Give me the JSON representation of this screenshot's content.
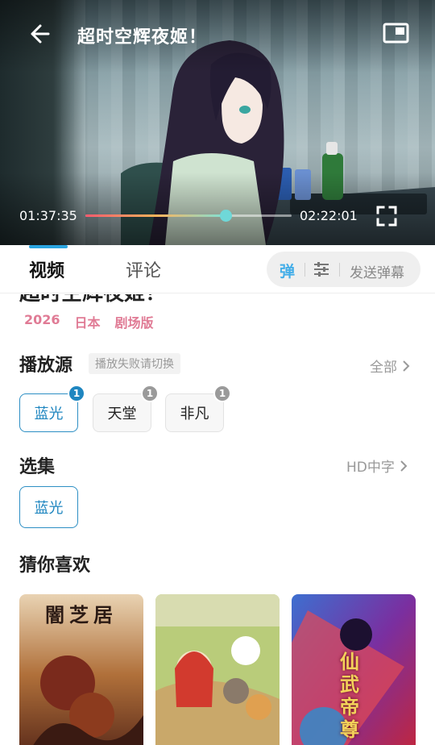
{
  "player": {
    "title": "超时空辉夜姬！",
    "current_time": "01:37:35",
    "total_time": "02:22:01",
    "progress": 0.68
  },
  "tabs": {
    "video": "视频",
    "comment": "评论"
  },
  "danmaku": {
    "toggle_label": "弹",
    "send_label": "发送弹幕"
  },
  "details": {
    "title": "超时空辉夜姬！",
    "year": "2026",
    "region": "日本",
    "kind": "剧场版"
  },
  "sources": {
    "heading": "播放源",
    "hint": "播放失败请切换",
    "more": "全部",
    "items": [
      {
        "label": "蓝光",
        "count": "1",
        "active": true
      },
      {
        "label": "天堂",
        "count": "1",
        "active": false
      },
      {
        "label": "非凡",
        "count": "1",
        "active": false
      }
    ]
  },
  "episodes": {
    "heading": "选集",
    "more": "HD中字",
    "items": [
      {
        "label": "蓝光"
      }
    ]
  },
  "recommend": {
    "heading": "猜你喜欢",
    "posters": [
      {
        "title": "闇芝居"
      },
      {
        "title": ""
      },
      {
        "title": "仙武帝尊"
      }
    ]
  },
  "colors": {
    "accent": "#2aa4e0",
    "meta_pink": "#e07b95",
    "chip_active": "#1f86c0"
  },
  "icons": [
    "back-arrow-icon",
    "picture-in-picture-icon",
    "fullscreen-icon",
    "danmaku-settings-icon",
    "chevron-right-icon"
  ]
}
